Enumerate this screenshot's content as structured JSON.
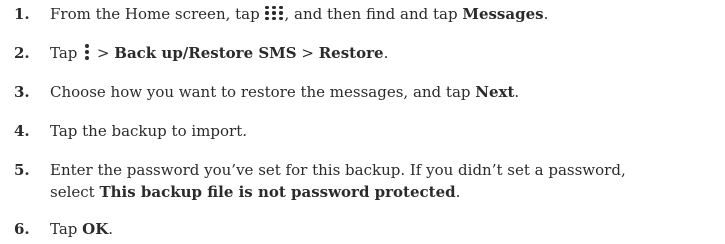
{
  "steps": [
    {
      "number": "1.",
      "parts": {
        "a": "From the Home screen, tap ",
        "b": ", and then find and tap ",
        "c": "Messages",
        "d": "."
      },
      "icon": "apps-grid-icon"
    },
    {
      "number": "2.",
      "parts": {
        "a": "Tap ",
        "b": " > ",
        "c": "Back up/Restore SMS",
        "d": " > ",
        "e": "Restore",
        "f": "."
      },
      "icon": "more-vertical-icon"
    },
    {
      "number": "3.",
      "parts": {
        "a": "Choose how you want to restore the messages, and tap ",
        "b": "Next",
        "c": "."
      }
    },
    {
      "number": "4.",
      "parts": {
        "a": "Tap the backup to import."
      }
    },
    {
      "number": "5.",
      "parts": {
        "a": "Enter the password you’ve set for this backup. If you didn’t set a password,",
        "b": "select ",
        "c": "This backup file is not password protected",
        "d": "."
      }
    },
    {
      "number": "6.",
      "parts": {
        "a": "Tap ",
        "b": "OK",
        "c": "."
      }
    }
  ]
}
